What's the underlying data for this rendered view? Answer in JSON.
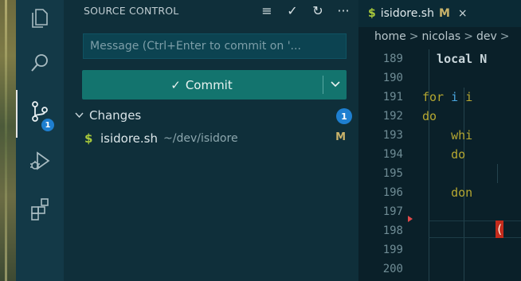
{
  "activity_bar": {
    "items": [
      {
        "name": "explorer",
        "icon": "files-icon"
      },
      {
        "name": "search",
        "icon": "search-icon"
      },
      {
        "name": "source-control",
        "icon": "source-control-icon",
        "badge": "1",
        "active": true
      },
      {
        "name": "run-debug",
        "icon": "run-debug-icon"
      },
      {
        "name": "extensions",
        "icon": "extensions-icon"
      }
    ]
  },
  "sidebar": {
    "title": "SOURCE CONTROL",
    "actions": [
      "≡",
      "✓",
      "↻",
      "···"
    ],
    "message_placeholder": "Message (Ctrl+Enter to commit on '...",
    "commit_label": "Commit",
    "commit_check": "✓",
    "commit_dropdown": "⌄",
    "changes": {
      "label": "Changes",
      "count": "1",
      "files": [
        {
          "icon": "$",
          "name": "isidore.sh",
          "path": "~/dev/isidore",
          "status": "M"
        }
      ]
    }
  },
  "editor": {
    "tab": {
      "icon": "$",
      "name": "isidore.sh",
      "modified": "M",
      "close": "×"
    },
    "breadcrumb": [
      "home",
      "nicolas",
      "dev"
    ],
    "line_numbers": [
      "189",
      "190",
      "191",
      "192",
      "193",
      "194",
      "195",
      "196",
      "197",
      "198",
      "199",
      "200"
    ],
    "code_lines": [
      {
        "text": "  local N",
        "class": "kw-b"
      },
      {
        "text": "",
        "class": ""
      },
      {
        "text": "for i i",
        "class": "kw-y",
        "var": "i"
      },
      {
        "text": "do",
        "class": "kw-y"
      },
      {
        "text": "    whi",
        "class": "kw-y"
      },
      {
        "text": "    do",
        "class": "kw-y"
      },
      {
        "text": "",
        "class": ""
      },
      {
        "text": "    don",
        "class": "kw-y"
      },
      {
        "text": "",
        "class": ""
      },
      {
        "text": "",
        "class": ""
      },
      {
        "text": "",
        "class": ""
      },
      {
        "text": "",
        "class": ""
      }
    ],
    "bracket_char": "(",
    "colors": {
      "accent": "#1e7fd0",
      "commit": "#13746e",
      "modified": "#c9b36a",
      "shell": "#a8c93b",
      "bracket_error": "#c42b1c"
    }
  }
}
